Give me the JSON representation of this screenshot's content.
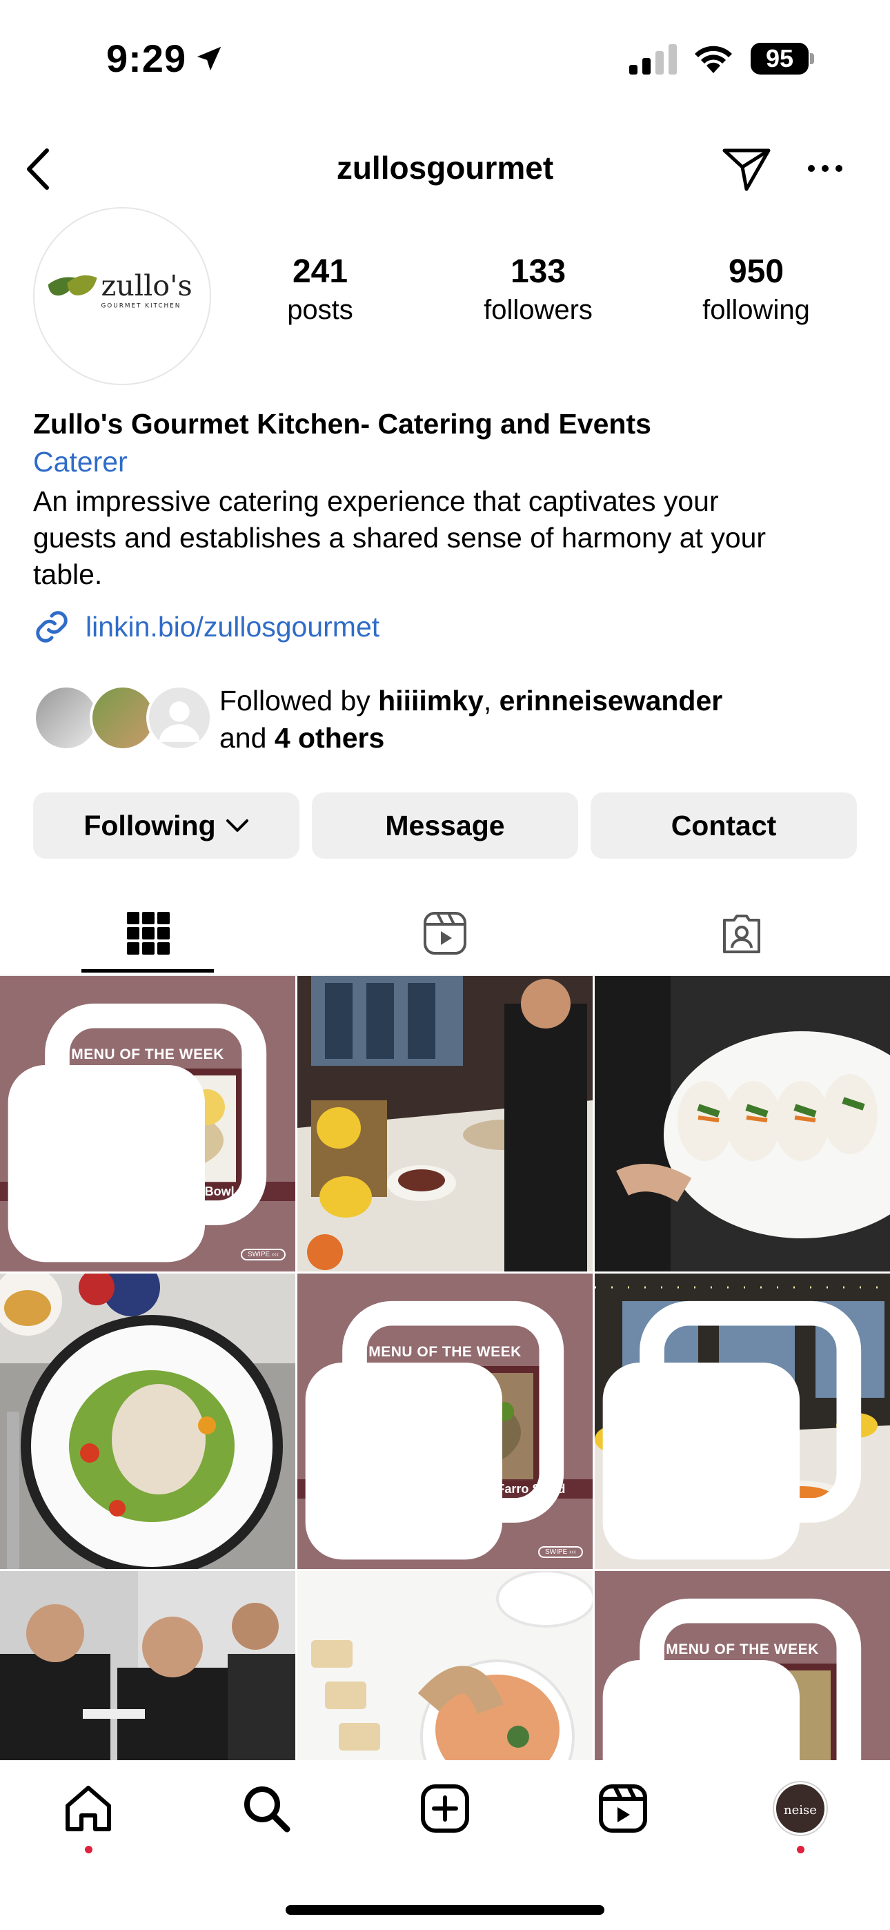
{
  "status_bar": {
    "time": "9:29",
    "battery": "95"
  },
  "header": {
    "username": "zullosgourmet"
  },
  "profile": {
    "logo_text": "zullo's",
    "logo_subtext": "GOURMET KITCHEN",
    "stats": [
      {
        "value": "241",
        "label": "posts"
      },
      {
        "value": "133",
        "label": "followers"
      },
      {
        "value": "950",
        "label": "following"
      }
    ],
    "name": "Zullo's Gourmet Kitchen- Catering and Events",
    "category": "Caterer",
    "bio_lines": [
      "An impressive catering experience that captivates your",
      "guests and establishes a shared sense of harmony at your",
      "table."
    ],
    "link": "linkin.bio/zullosgourmet",
    "followed_by": {
      "prefix": "Followed by ",
      "user1": "hiiiimky",
      "separator": ", ",
      "user2": "erinneisewander",
      "line2_prefix": "and ",
      "others": "4 others"
    }
  },
  "actions": {
    "following": "Following",
    "message": "Message",
    "contact": "Contact"
  },
  "tabs": [
    "grid-icon",
    "reels-icon",
    "tagged-icon"
  ],
  "posts": [
    {
      "type": "menu",
      "title": "MENU OF THE WEEK",
      "caption": "Spinach Artichoke Orzo Bowl",
      "swipe": "SWIPE ‹‹‹",
      "multi": true
    },
    {
      "type": "photo",
      "subject": "catering buffet",
      "multi": false
    },
    {
      "type": "photo",
      "subject": "bao buns",
      "multi": false
    },
    {
      "type": "photo",
      "subject": "salad plate",
      "multi": false
    },
    {
      "type": "menu",
      "title": "MENU OF THE WEEK",
      "caption": "Tuscan Roasted Vegetable & Farro Salad",
      "swipe": "SWIPE ‹‹‹",
      "multi": true
    },
    {
      "type": "photo",
      "subject": "buffet table",
      "multi": true
    },
    {
      "type": "photo",
      "subject": "toast",
      "multi": false
    },
    {
      "type": "photo",
      "subject": "soup",
      "multi": false
    },
    {
      "type": "menu",
      "title": "MENU OF THE WEEK",
      "caption": "",
      "multi": true
    }
  ],
  "bottom_bar": {
    "profile_avatar_text": "neise"
  },
  "colors": {
    "link": "#2f6cc8",
    "button_bg": "#efefef",
    "menu_overlay": "#8a6468",
    "notification_dot": "#e0213d"
  }
}
